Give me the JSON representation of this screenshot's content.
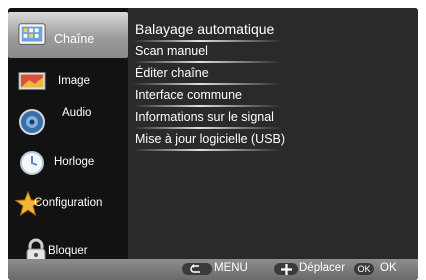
{
  "sidebar": {
    "items": [
      {
        "label": "Chaîne",
        "icon": "tv-channel-icon",
        "active": true
      },
      {
        "label": "Image",
        "icon": "picture-icon"
      },
      {
        "label": "Audio",
        "icon": "speaker-icon"
      },
      {
        "label": "Horloge",
        "icon": "clock-icon"
      },
      {
        "label": "Configuration",
        "icon": "star-settings-icon"
      },
      {
        "label": "Bloquer",
        "icon": "lock-icon"
      }
    ]
  },
  "menu": {
    "items": [
      "Balayage automatique",
      "Scan manuel",
      "Éditer chaîne",
      "Interface commune",
      "Informations sur le signal",
      "Mise à jour logicielle (USB)"
    ]
  },
  "footer": {
    "menu_label": "MENU",
    "move_label": "Déplacer",
    "ok_key": "OK",
    "ok_label": "OK"
  },
  "colors": {
    "panel": "#222222",
    "sidebar": "#121212",
    "active_item": "#a8a8a8",
    "footer": "#7a7a7a"
  }
}
